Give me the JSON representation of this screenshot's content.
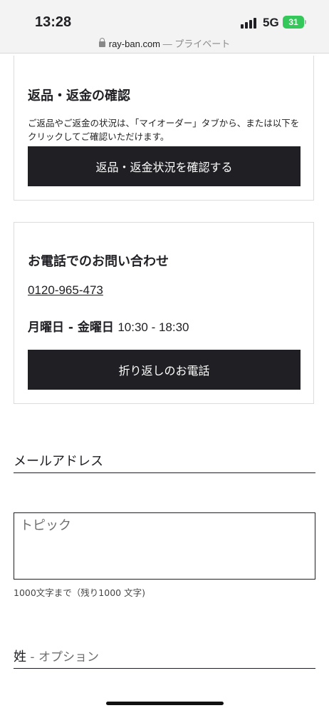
{
  "status_bar": {
    "time": "13:28",
    "network": "5G",
    "battery": "31"
  },
  "url_bar": {
    "domain": "ray-ban.com",
    "mode": "— プライベート"
  },
  "returns": {
    "title": "返品・返金の確認",
    "description": "ご返品やご返金の状況は、「マイオーダー」タブから、または以下をクリックしてご確認いただけます。",
    "button": "返品・返金状況を確認する"
  },
  "contact": {
    "title": "お電話でのお問い合わせ",
    "phone": "0120-965-473",
    "hours_days": "月曜日 - 金曜日",
    "hours_time": "10:30 - 18:30",
    "callback_button": "折り返しのお電話"
  },
  "form": {
    "email_label": "メールアドレス",
    "topic_placeholder": "トピック",
    "char_counter": "1000文字まで（残り1000 文字)",
    "surname_label": "姓",
    "surname_optional": " - オプション"
  }
}
